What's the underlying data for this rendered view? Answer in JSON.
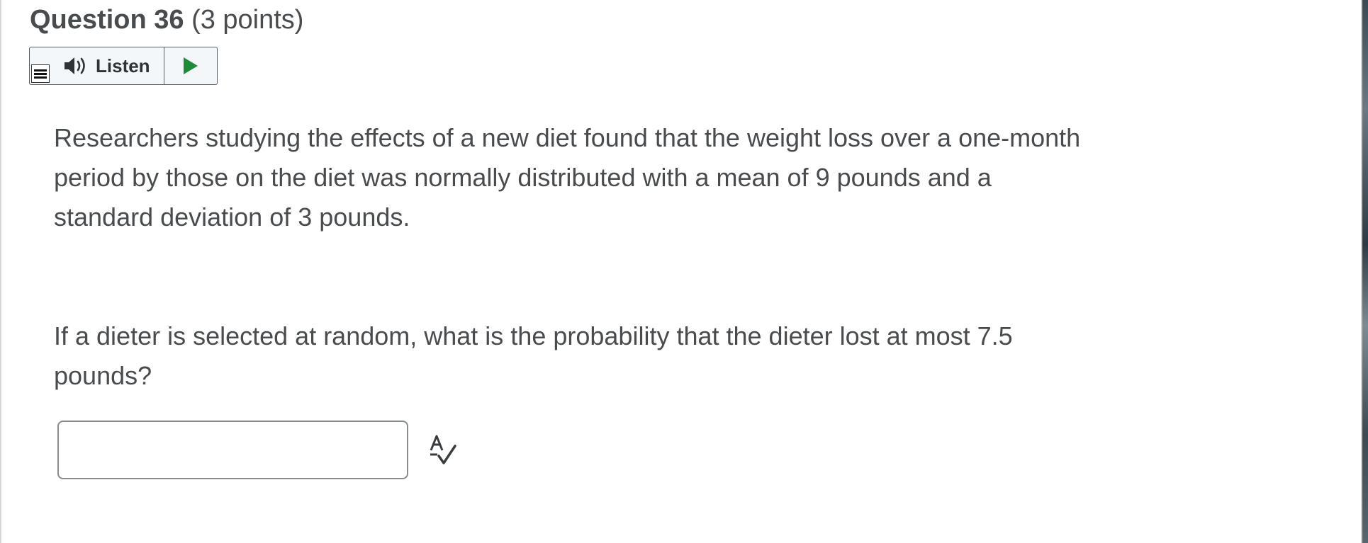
{
  "question": {
    "title": "Question 36",
    "points": "(3 points)"
  },
  "listen_widget": {
    "label": "Listen",
    "icons": [
      "menu-icon",
      "speaker-icon",
      "play-icon"
    ],
    "play_color": "#1f8a3a"
  },
  "body": {
    "paragraph_1": "Researchers studying the effects of a new diet found that the weight loss over a one-month period by those on the diet was normally distributed with a mean of 9 pounds and a standard deviation of 3 pounds.",
    "paragraph_2": "If a dieter is selected at random, what is the probability that the dieter lost at most 7.5 pounds?"
  },
  "answer": {
    "value": "",
    "placeholder": ""
  },
  "spellcheck": {
    "icon": "spellcheck-icon"
  }
}
